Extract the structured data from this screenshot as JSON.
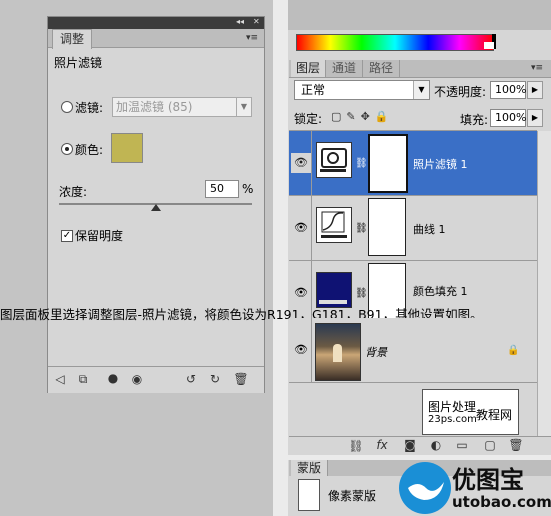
{
  "adjustments_panel": {
    "title_bar_controls": [
      "◂◂",
      "×"
    ],
    "tab_label": "调整",
    "panel_title": "照片滤镜",
    "filter_option_label": "滤镜:",
    "filter_select_value": "加温滤镜 (85)",
    "color_option_label": "颜色:",
    "color_swatch": "#c0b553",
    "density_label": "浓度:",
    "density_value": "50",
    "density_unit": "%",
    "density_level_percent": 50,
    "preserve_luminosity_label": "保留明度",
    "preserve_luminosity_checked": true
  },
  "layers_panel": {
    "tabs": [
      "图层",
      "通道",
      "路径"
    ],
    "blend_mode": "正常",
    "opacity_label": "不透明度:",
    "opacity_value": "100%",
    "lock_label": "锁定:",
    "fill_label": "填充:",
    "fill_value": "100%",
    "layers": [
      {
        "name": "照片滤镜 1",
        "selected": true
      },
      {
        "name": "曲线 1",
        "selected": false
      },
      {
        "name": "颜色填充 1",
        "selected": false
      },
      {
        "name": "背景",
        "selected": false
      }
    ],
    "watermark_line1": "图片处理",
    "watermark_line2": "23ps.com",
    "watermark_line3": "教程网"
  },
  "masks_panel": {
    "tab_label": "蒙版",
    "pixel_mask_label": "像素蒙版"
  },
  "caption": "图层面板里选择调整图层-照片滤镜，将颜色设为R191，G181，B91，其他设置如图。",
  "logo": {
    "text": "优图宝",
    "url_text": "utobao.com"
  },
  "colors": {
    "selected_layer": "#3a6fc6",
    "panel_bg": "#d6d6d6",
    "fill_layer_color": "#0f1273"
  }
}
